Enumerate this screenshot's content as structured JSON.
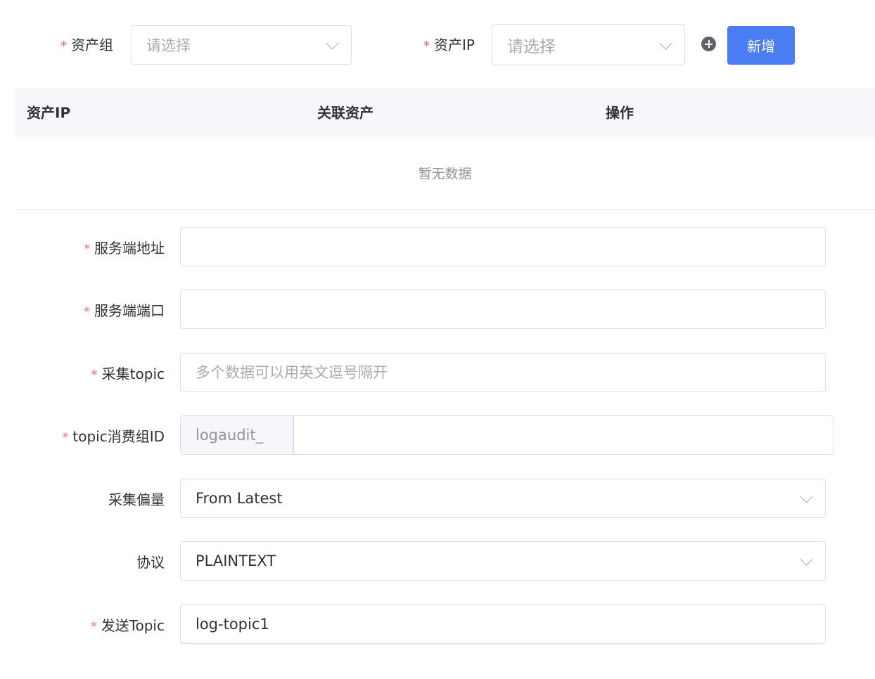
{
  "top_filter": {
    "asset_group": {
      "label": "资产组",
      "placeholder": "请选择"
    },
    "asset_ip": {
      "label": "资产IP",
      "placeholder": "请选择"
    },
    "add_button_label": "新增"
  },
  "table": {
    "columns": [
      "资产IP",
      "关联资产",
      "操作"
    ],
    "empty_text": "暂无数据"
  },
  "form": {
    "server_address": {
      "label": "服务端地址",
      "value": ""
    },
    "server_port": {
      "label": "服务端端口",
      "value": ""
    },
    "collect_topic": {
      "label": "采集topic",
      "placeholder": "多个数据可以用英文逗号隔开",
      "value": ""
    },
    "consumer_group_id": {
      "label": "topic消费组ID",
      "prefix": "logaudit_",
      "value": ""
    },
    "offset": {
      "label": "采集偏量",
      "value": "From Latest"
    },
    "protocol": {
      "label": "协议",
      "value": "PLAINTEXT"
    },
    "send_topic": {
      "label": "发送Topic",
      "value": "log-topic1"
    }
  },
  "icons": {
    "add_circle": "plus-circle-icon",
    "chevron": "chevron-down-icon"
  },
  "colors": {
    "primary": "#4a7cf3",
    "required": "#f56c6c",
    "header_bg": "#f5f7fa",
    "border": "#dcdfe6"
  }
}
